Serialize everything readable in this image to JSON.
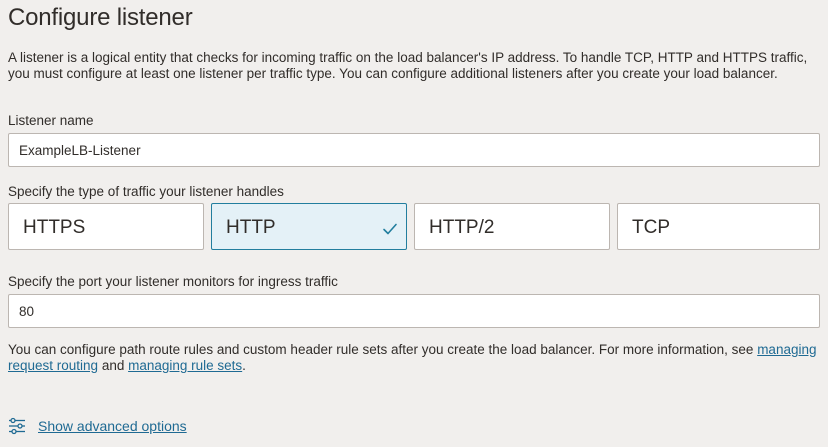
{
  "page": {
    "title": "Configure listener",
    "description": "A listener is a logical entity that checks for incoming traffic on the load balancer's IP address. To handle TCP, HTTP and HTTPS traffic, you must configure at least one listener per traffic type. You can configure additional listeners after you create your load balancer."
  },
  "listener_name": {
    "label": "Listener name",
    "value": "ExampleLB-Listener"
  },
  "traffic_type": {
    "label": "Specify the type of traffic your listener handles",
    "options": [
      {
        "label": "HTTPS",
        "selected": false
      },
      {
        "label": "HTTP",
        "selected": true
      },
      {
        "label": "HTTP/2",
        "selected": false
      },
      {
        "label": "TCP",
        "selected": false
      }
    ]
  },
  "port": {
    "label": "Specify the port your listener monitors for ingress traffic",
    "value": "80"
  },
  "note": {
    "text_before": "You can configure path route rules and custom header rule sets after you create the load balancer. For more information, see ",
    "link1": "managing request routing",
    "text_between": " and ",
    "link2": "managing rule sets",
    "text_after": "."
  },
  "advanced": {
    "label": "Show advanced options",
    "icon": "sliders-icon"
  },
  "colors": {
    "background": "#f1efed",
    "link": "#1f6a93",
    "selected_tile_bg": "#e4f1f7",
    "selected_tile_border": "#227e9e"
  }
}
